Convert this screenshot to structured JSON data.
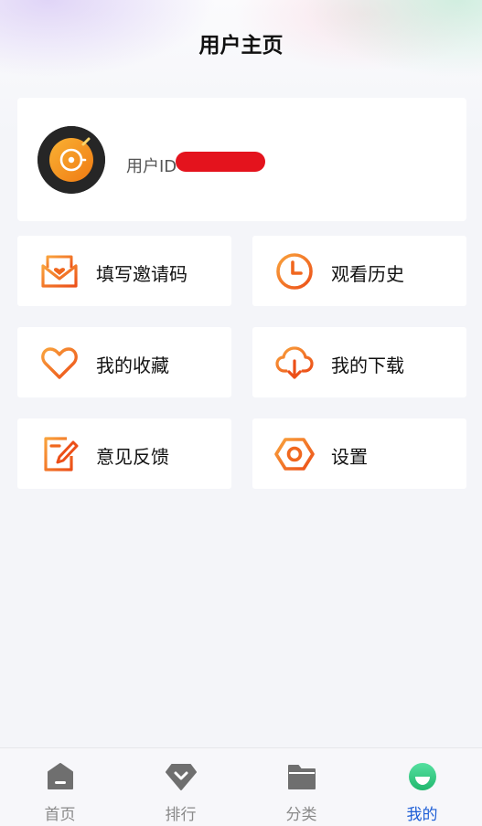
{
  "header": {
    "title": "用户主页"
  },
  "profile": {
    "user_id_label": "用户ID"
  },
  "menu": [
    {
      "label": "填写邀请码",
      "icon": "invite-envelope-icon"
    },
    {
      "label": "观看历史",
      "icon": "clock-icon"
    },
    {
      "label": "我的收藏",
      "icon": "heart-icon"
    },
    {
      "label": "我的下载",
      "icon": "cloud-download-icon"
    },
    {
      "label": "意见反馈",
      "icon": "feedback-edit-icon"
    },
    {
      "label": "设置",
      "icon": "settings-hexagon-icon"
    }
  ],
  "tabbar": {
    "tabs": [
      {
        "label": "首页",
        "icon": "home-icon"
      },
      {
        "label": "排行",
        "icon": "ranking-diamond-icon"
      },
      {
        "label": "分类",
        "icon": "folder-icon"
      },
      {
        "label": "我的",
        "icon": "profile-smile-icon"
      }
    ],
    "active": "我的"
  },
  "colors": {
    "accent_orange": "#f0671e",
    "accent_orange_light": "#f9a23c",
    "tab_active": "#1f5fd6",
    "tab_inactive": "#8a8a8a",
    "redaction": "#e4131d",
    "profile_icon_green": "#3fd08a"
  }
}
